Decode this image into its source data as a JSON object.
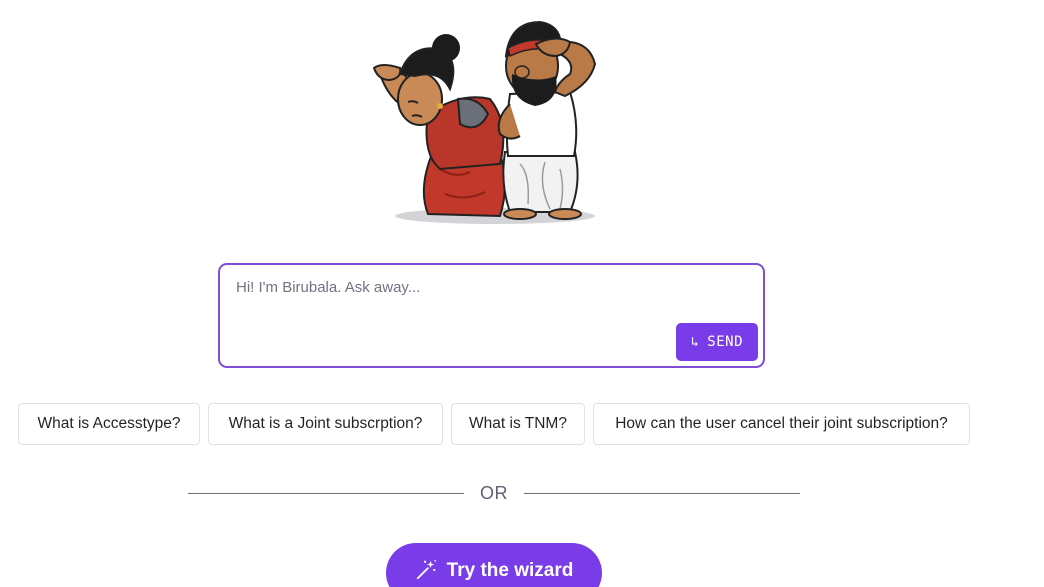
{
  "chat": {
    "placeholder": "Hi! I'm Birubala. Ask away...",
    "send_icon": "↳",
    "send_label": "SEND"
  },
  "suggestions": [
    "What is Accesstype?",
    "What is a Joint subscrption?",
    "What is TNM?",
    "How can the user cancel their joint subscription?"
  ],
  "divider_text": "OR",
  "wizard": {
    "label": "Try the wizard",
    "icon": "magic-wand-icon"
  },
  "colors": {
    "accent": "#7a3ce8",
    "input_border": "#7e4fd6"
  },
  "illustration": {
    "icon": "mascot-couple-illustration"
  }
}
